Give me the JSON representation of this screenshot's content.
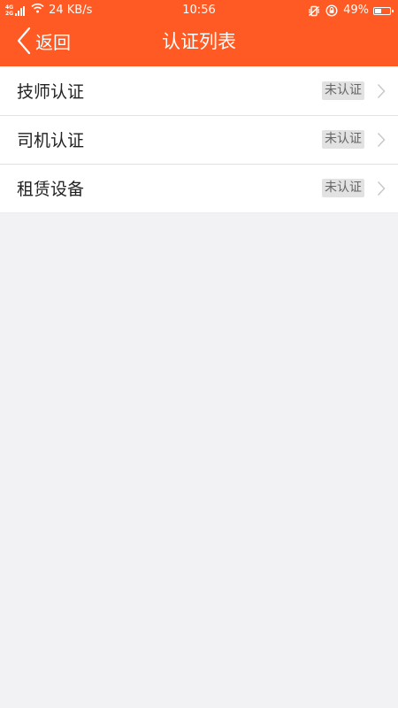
{
  "statusbar": {
    "network_type": "4G 2G",
    "speed": "24 KB/s",
    "time": "10:56",
    "battery": "49%",
    "battery_level": 0.49
  },
  "navbar": {
    "back_label": "返回",
    "title": "认证列表"
  },
  "list": {
    "items": [
      {
        "label": "技师认证",
        "status": "未认证"
      },
      {
        "label": "司机认证",
        "status": "未认证"
      },
      {
        "label": "租赁设备",
        "status": "未认证"
      }
    ]
  },
  "colors": {
    "accent": "#ff5a23",
    "background": "#f2f2f4",
    "badge_bg": "#e2e2e2"
  },
  "icons": {
    "back": "chevron-left-icon",
    "row_arrow": "chevron-right-icon",
    "wifi": "wifi-icon",
    "vibrate": "vibrate-off-icon",
    "rotation_lock": "rotation-lock-icon",
    "battery": "battery-icon"
  }
}
